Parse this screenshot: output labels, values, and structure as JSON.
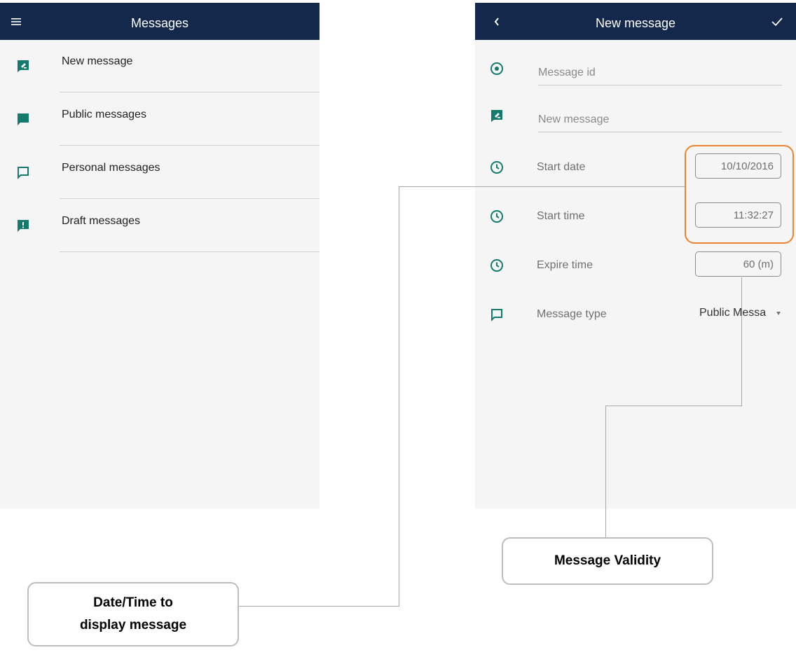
{
  "left_screen": {
    "header": {
      "title": "Messages",
      "menu_icon": "hamburger-menu-icon"
    },
    "menu_items": [
      {
        "label": "New message",
        "icon": "compose-message-icon"
      },
      {
        "label": "Public messages",
        "icon": "chat-filled-icon"
      },
      {
        "label": "Personal messages",
        "icon": "chat-outline-icon"
      },
      {
        "label": "Draft messages",
        "icon": "chat-alert-icon"
      }
    ]
  },
  "right_screen": {
    "header": {
      "title": "New message",
      "back_icon": "chevron-left-icon",
      "confirm_icon": "checkmark-icon"
    },
    "form": {
      "message_id": {
        "placeholder": "Message id",
        "icon": "radio-target-icon"
      },
      "new_message": {
        "placeholder": "New message",
        "icon": "compose-message-icon"
      },
      "start_date": {
        "label": "Start date",
        "value": "10/10/2016",
        "icon": "clock-icon"
      },
      "start_time": {
        "label": "Start time",
        "value": "11:32:27",
        "icon": "clock-icon"
      },
      "expire_time": {
        "label": "Expire time",
        "value": "60 (m)",
        "icon": "clock-icon"
      },
      "message_type": {
        "label": "Message type",
        "value": "Public Messa",
        "icon": "chat-outline-icon"
      }
    }
  },
  "annotations": {
    "date_time": {
      "line1": "Date/Time to",
      "line2": "display message"
    },
    "validity": {
      "text": "Message Validity"
    }
  },
  "colors": {
    "header": "#13284a",
    "accent": "#137a6d",
    "highlight": "#e9862e",
    "background": "#f5f5f5"
  }
}
